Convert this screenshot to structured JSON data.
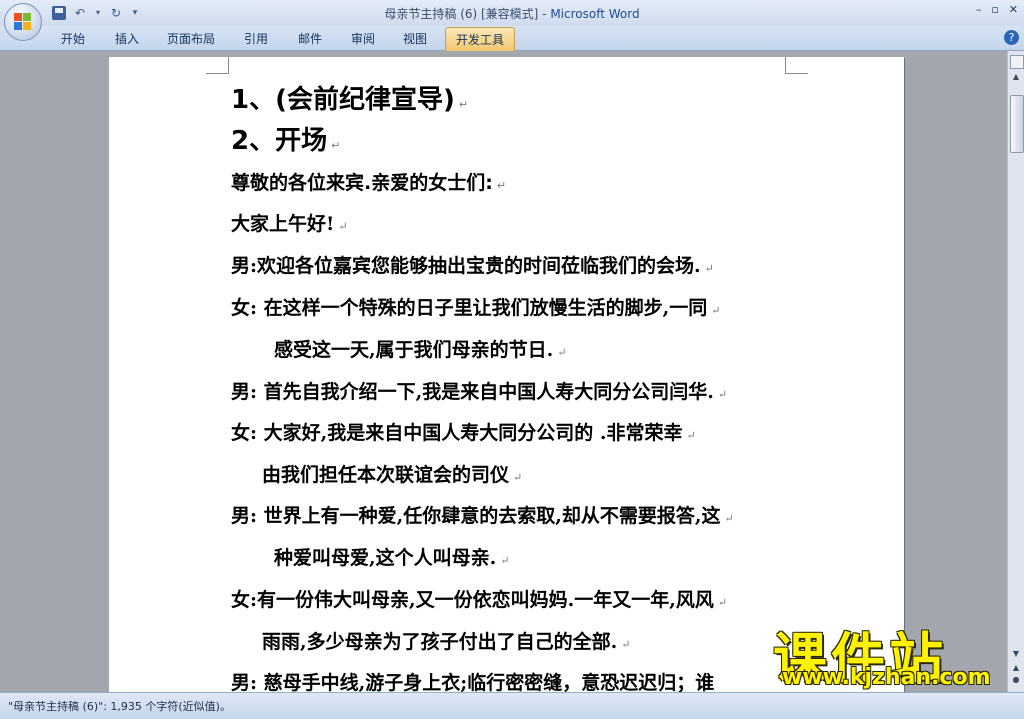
{
  "window": {
    "title": "母亲节主持稿 (6) [兼容模式] - ",
    "app_name": "Microsoft Word",
    "controls": [
      "–",
      "▫",
      "✕"
    ]
  },
  "ribbon": {
    "tabs": [
      {
        "label": "开始"
      },
      {
        "label": "插入"
      },
      {
        "label": "页面布局"
      },
      {
        "label": "引用"
      },
      {
        "label": "邮件"
      },
      {
        "label": "审阅"
      },
      {
        "label": "视图"
      },
      {
        "label": "开发工具",
        "active": true
      }
    ],
    "help": "?"
  },
  "document": {
    "lines": [
      {
        "text": "1、(会前纪律宣导)"
      },
      {
        "text": "2、开场"
      },
      {
        "text": "尊敬的各位来宾.亲爱的女士们:"
      },
      {
        "text": "大家上午好!"
      },
      {
        "text": "男:欢迎各位嘉宾您能够抽出宝贵的时间莅临我们的会场."
      },
      {
        "text": "女: 在这样一个特殊的日子里让我们放慢生活的脚步,一同"
      },
      {
        "text": "感受这一天,属于我们母亲的节日."
      },
      {
        "text": "男: 首先自我介绍一下,我是来自中国人寿大同分公司闫华."
      },
      {
        "text": "女: 大家好,我是来自中国人寿大同分公司的    .非常荣幸"
      },
      {
        "text": "由我们担任本次联谊会的司仪"
      },
      {
        "text": "男: 世界上有一种爱,任你肆意的去索取,却从不需要报答,这"
      },
      {
        "text": "种爱叫母爱,这个人叫母亲."
      },
      {
        "text": "女:有一份伟大叫母亲,又一份依恋叫妈妈.一年又一年,风风"
      },
      {
        "text": "雨雨,多少母亲为了孩子付出了自己的全部."
      },
      {
        "text": "男: 慈母手中线,游子身上衣;临行密密缝，意恐迟迟归；谁"
      }
    ],
    "paragraph_mark": "↵"
  },
  "watermark": {
    "title": "课件站",
    "url": "www.kjzhan.com"
  },
  "status": {
    "text": "\"母亲节主持稿 (6)\": 1,935 个字符(近似值)。"
  }
}
